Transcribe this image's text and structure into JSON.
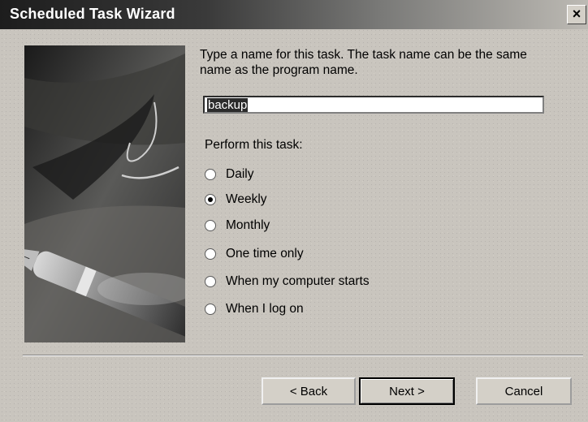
{
  "window": {
    "title": "Scheduled Task Wizard",
    "close_glyph": "×"
  },
  "main": {
    "prompt": "Type a name for this task. The task name can be the same name as the program name.",
    "task_name_value": "backup",
    "perform_label": "Perform this task:",
    "options": [
      {
        "label": "Daily",
        "checked": false
      },
      {
        "label": "Weekly",
        "checked": true
      },
      {
        "label": "Monthly",
        "checked": false
      },
      {
        "label": "One time only",
        "checked": false
      },
      {
        "label": "When my computer starts",
        "checked": false
      },
      {
        "label": "When I log on",
        "checked": false
      }
    ]
  },
  "buttons": {
    "back": "< Back",
    "next": "Next >",
    "cancel": "Cancel"
  },
  "icons": {
    "illustration": "fountain-pen-illustration",
    "radio": "radio-button-icon"
  }
}
